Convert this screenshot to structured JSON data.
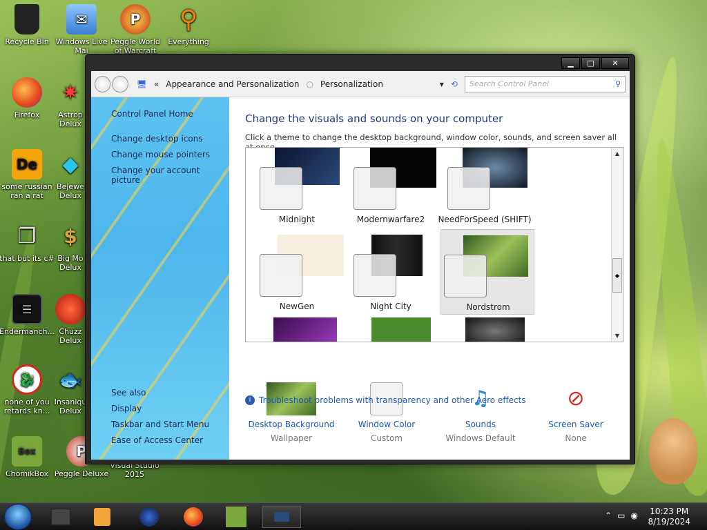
{
  "desktop": {
    "icons": [
      {
        "label": "Recycle Bin"
      },
      {
        "label": "Windows Live Mai"
      },
      {
        "label": "Peggle World of Warcraft"
      },
      {
        "label": "Everything"
      },
      {
        "label": "Firefox"
      },
      {
        "label": "Astrop Delux"
      },
      {
        "label": "some russian ran a rat"
      },
      {
        "label": "Bejewe Delux"
      },
      {
        "label": "that but its c#"
      },
      {
        "label": "Big Mo Delux"
      },
      {
        "label": "Endermanch..."
      },
      {
        "label": "Chuzz Delux"
      },
      {
        "label": "none of you retards kn..."
      },
      {
        "label": "Insaniqu Delux"
      },
      {
        "label": "ChomikBox"
      },
      {
        "label": "Peggle Deluxe"
      },
      {
        "label": "Visual Studio 2015"
      }
    ]
  },
  "window": {
    "breadcrumb": [
      "Appearance and Personalization",
      "Personalization"
    ],
    "breadcrumb_prefix": "«",
    "search_placeholder": "Search Control Panel",
    "caption": {
      "minimize": "▁",
      "maximize": "□",
      "close": "✕"
    }
  },
  "sidebar": {
    "home": "Control Panel Home",
    "links": [
      "Change desktop icons",
      "Change mouse pointers",
      "Change your account picture"
    ],
    "see_also": "See also",
    "see_links": [
      "Display",
      "Taskbar and Start Menu",
      "Ease of Access Center"
    ]
  },
  "main": {
    "title": "Change the visuals and sounds on your computer",
    "subtitle": "Click a theme to change the desktop background, window color, sounds, and screen saver all at once.",
    "themes": [
      {
        "name": "Midnight",
        "color": "#1a2a4a"
      },
      {
        "name": "Modernwarfare2",
        "color": "#050505"
      },
      {
        "name": "NeedForSpeed (SHIFT)",
        "color": "#202a35"
      },
      {
        "name": "NewGen",
        "color": "#f6efe0"
      },
      {
        "name": "Night City",
        "color": "#151515"
      },
      {
        "name": "Nordstrom",
        "color": "#6aa33b"
      }
    ],
    "options": [
      {
        "label": "Desktop Background",
        "sub": "Wallpaper"
      },
      {
        "label": "Window Color",
        "sub": "Custom"
      },
      {
        "label": "Sounds",
        "sub": "Windows Default"
      },
      {
        "label": "Screen Saver",
        "sub": "None"
      }
    ],
    "trouble": "Troubleshoot problems with transparency and other Aero effects"
  },
  "taskbar": {
    "time": "10:23 PM",
    "date": "8/19/2024"
  }
}
